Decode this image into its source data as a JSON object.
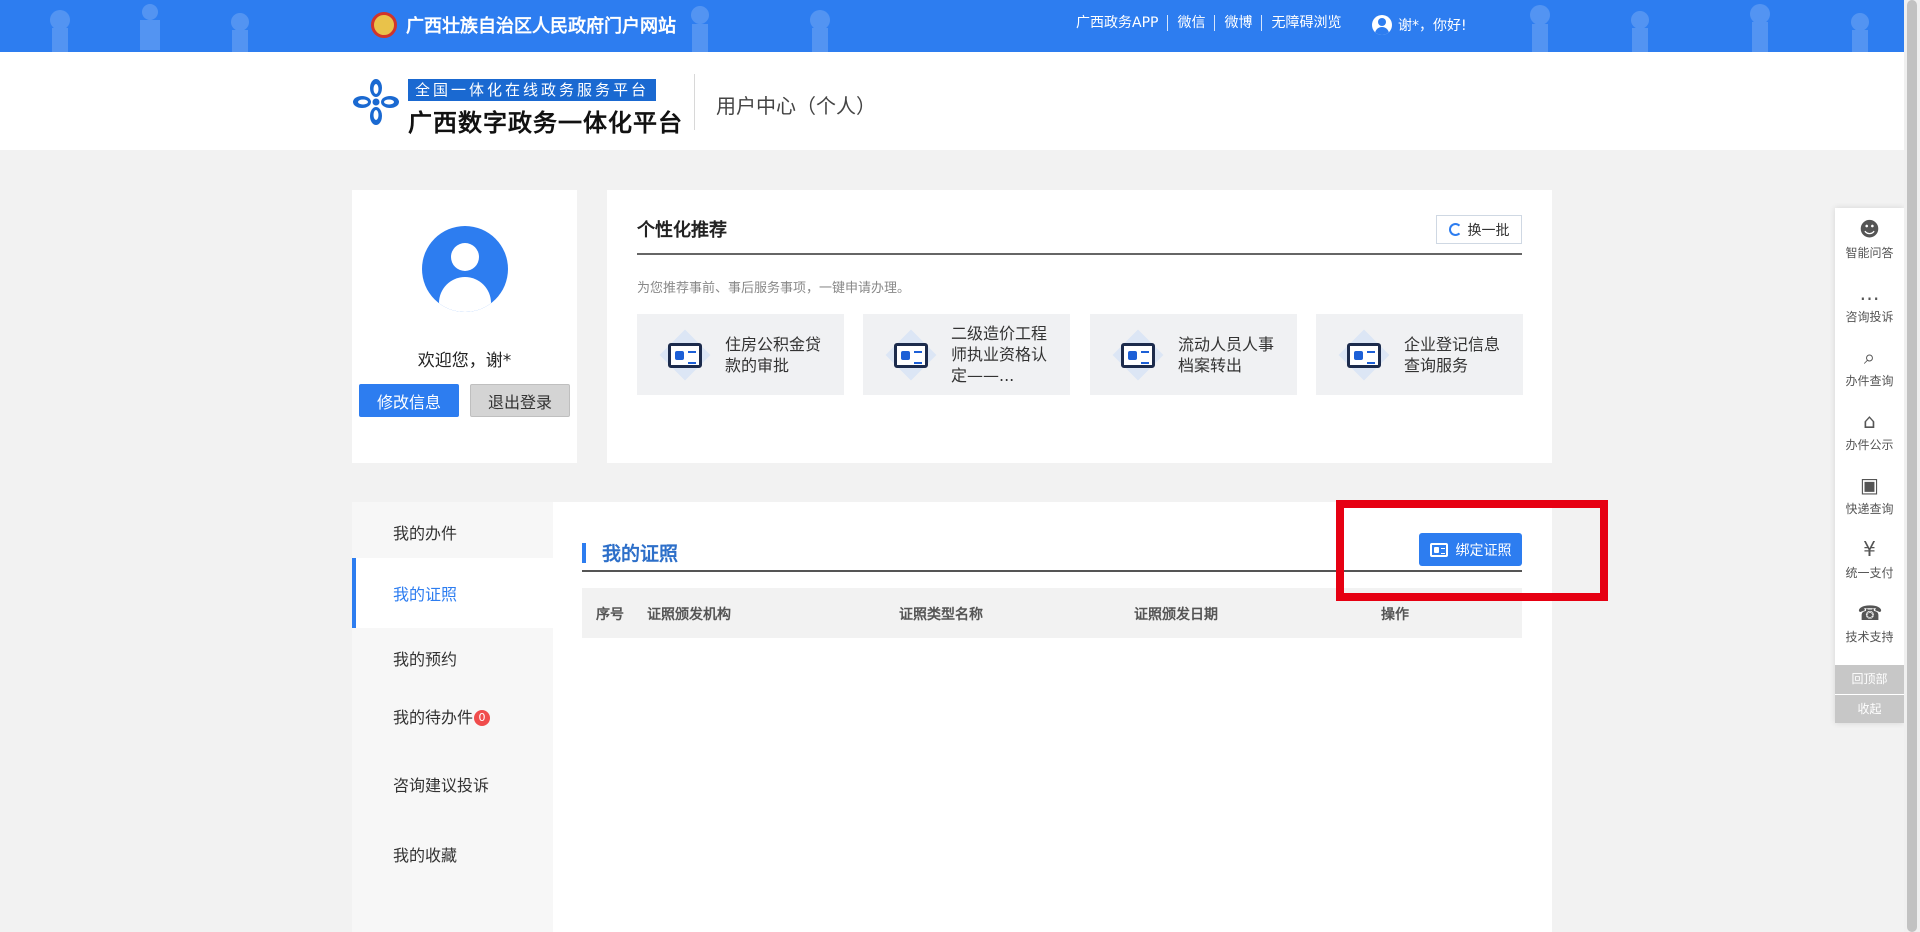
{
  "topbar": {
    "site_name": "广西壮族自治区人民政府门户网站",
    "links": [
      "广西政务APP",
      "微信",
      "微博",
      "无障碍浏览"
    ],
    "greeting": "谢*，你好!"
  },
  "header": {
    "logo_sub": "全国一体化在线政务服务平台",
    "logo_main": "广西数字政务一体化平台",
    "page_title": "用户中心（个人）"
  },
  "profile": {
    "welcome": "欢迎您，谢*",
    "edit_label": "修改信息",
    "logout_label": "退出登录"
  },
  "recommend": {
    "title": "个性化推荐",
    "refresh_label": "换一批",
    "description": "为您推荐事前、事后服务事项，一键申请办理。",
    "items": [
      {
        "label": "住房公积金贷款的审批"
      },
      {
        "label": "二级造价工程师执业资格认定——..."
      },
      {
        "label": "流动人员人事档案转出"
      },
      {
        "label": "企业登记信息查询服务"
      }
    ]
  },
  "nav": {
    "items": [
      {
        "label": "我的办件"
      },
      {
        "label": "我的证照"
      },
      {
        "label": "我的预约"
      },
      {
        "label": "我的待办件",
        "badge": "0"
      },
      {
        "label": "咨询建议投诉"
      },
      {
        "label": "我的收藏"
      }
    ],
    "active": "我的证照"
  },
  "main": {
    "title": "我的证照",
    "bind_label": "绑定证照",
    "columns": [
      "序号",
      "证照颁发机构",
      "证照类型名称",
      "证照颁发日期",
      "操作"
    ]
  },
  "sidebar": {
    "items": [
      {
        "label": "智能问答",
        "icon": "robot-icon",
        "glyph": "☻"
      },
      {
        "label": "咨询投诉",
        "icon": "chat-icon",
        "glyph": "…"
      },
      {
        "label": "办件查询",
        "icon": "search-document-icon",
        "glyph": "⌕"
      },
      {
        "label": "办件公示",
        "icon": "notice-icon",
        "glyph": "⌂"
      },
      {
        "label": "快递查询",
        "icon": "package-icon",
        "glyph": "▣"
      },
      {
        "label": "统一支付",
        "icon": "yen-icon",
        "glyph": "¥"
      },
      {
        "label": "技术支持",
        "icon": "headset-icon",
        "glyph": "☎"
      }
    ],
    "back_top": "回顶部",
    "collapse": "收起"
  },
  "colors": {
    "primary": "#2d7df0",
    "highlight": "#e60012",
    "badge": "#f04c4c"
  }
}
